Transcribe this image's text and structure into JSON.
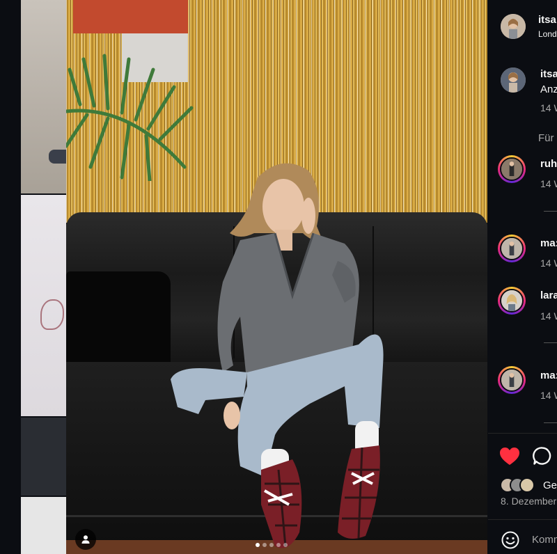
{
  "post": {
    "author_username": "itsa",
    "location": "Lond",
    "carousel": {
      "count": 5,
      "active_index": 0
    }
  },
  "caption": {
    "username": "itsa",
    "text": "Anz",
    "time": "14 W"
  },
  "section_label": "Für",
  "comments": [
    {
      "username": "ruh",
      "time": "14 W"
    },
    {
      "username": "ma:",
      "time": "14 W"
    },
    {
      "username": "lara",
      "time": "14 W"
    },
    {
      "username": "ma:",
      "time": "14 W"
    }
  ],
  "actions": {
    "like_color": "#ff3040",
    "liked_by_text": "Ge",
    "date": "8. Dezember",
    "comment_placeholder": "Komm"
  },
  "colors": {
    "panel_bg": "#0b0d12",
    "text": "#f5f5f5",
    "muted": "#a8a8a8"
  }
}
